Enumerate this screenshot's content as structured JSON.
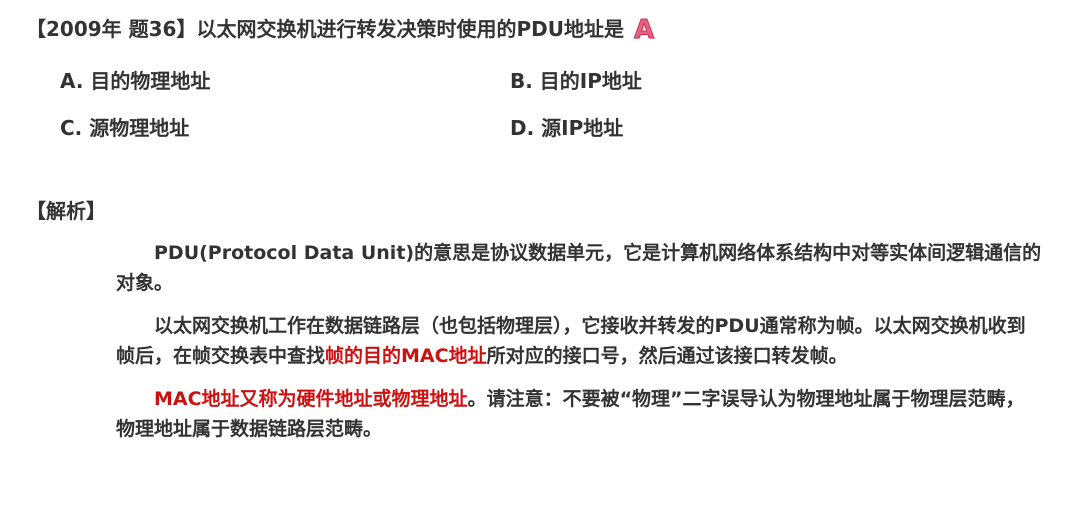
{
  "question": {
    "text": "【2009年 题36】以太网交换机进行转发决策时使用的PDU地址是",
    "answer": "A"
  },
  "options": {
    "a": "A. 目的物理地址",
    "b": "B. 目的IP地址",
    "c": "C. 源物理地址",
    "d": "D. 源IP地址"
  },
  "analysis": {
    "title": "【解析】",
    "p1": "PDU(Protocol Data Unit)的意思是协议数据单元，它是计算机网络体系结构中对等实体间逻辑通信的对象。",
    "p2_a": "以太网交换机工作在数据链路层（也包括物理层），它接收并转发的PDU通常称为帧。以太网交换机收到帧后，在帧交换表中查找",
    "p2_highlight": "帧的目的MAC地址",
    "p2_b": "所对应的接口号，然后通过该接口转发帧。",
    "p3_highlight": "MAC地址又称为硬件地址或物理地址",
    "p3_b": "。请注意：不要被“物理”二字误导认为物理地址属于物理层范畴，物理地址属于数据链路层范畴。"
  },
  "colors": {
    "text": "#333333",
    "highlight": "#cc1111",
    "answer": "#e8607f"
  }
}
